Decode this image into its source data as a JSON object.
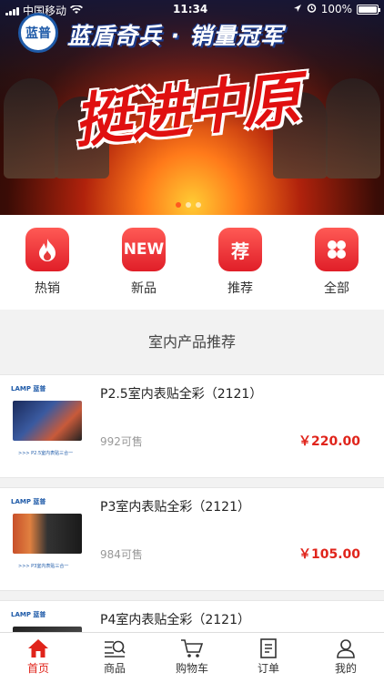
{
  "status_bar": {
    "carrier": "中国移动",
    "time": "11:34",
    "battery": "100%"
  },
  "banner": {
    "logo_text": "蓝普",
    "slogan": "蓝盾奇兵 · 销量冠军",
    "calligraphy": "挺进中原",
    "page_count": 3,
    "active_page": 1
  },
  "categories": [
    {
      "label": "热销",
      "icon": "fire-icon"
    },
    {
      "label": "新品",
      "icon": "new-icon",
      "icon_text": "NEW"
    },
    {
      "label": "推荐",
      "icon": "recommend-icon",
      "icon_text": "荐"
    },
    {
      "label": "全部",
      "icon": "grid-icon"
    }
  ],
  "section_title": "室内产品推荐",
  "products": [
    {
      "name": "P2.5室内表贴全彩（2121）",
      "sold": "992可售",
      "price": "￥220.00",
      "brand": "LAMP 蓝普",
      "caption": ">>> P2.5室内表贴三合一"
    },
    {
      "name": "P3室内表贴全彩（2121）",
      "sold": "984可售",
      "price": "￥105.00",
      "brand": "LAMP 蓝普",
      "caption": ">>> P3室内表贴三合一"
    },
    {
      "name": "P4室内表贴全彩（2121）",
      "brand": "LAMP 蓝普"
    }
  ],
  "tabbar": [
    {
      "label": "首页",
      "icon": "home-icon",
      "active": true
    },
    {
      "label": "商品",
      "icon": "product-icon"
    },
    {
      "label": "购物车",
      "icon": "cart-icon"
    },
    {
      "label": "订单",
      "icon": "order-icon"
    },
    {
      "label": "我的",
      "icon": "user-icon"
    }
  ],
  "colors": {
    "accent": "#e0241b",
    "brand_blue": "#1e5aa8"
  }
}
